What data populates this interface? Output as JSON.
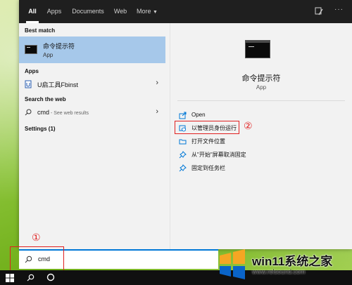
{
  "tabs": [
    {
      "label": "All",
      "active": true
    },
    {
      "label": "Apps"
    },
    {
      "label": "Documents"
    },
    {
      "label": "Web"
    },
    {
      "label": "More"
    }
  ],
  "left": {
    "best_match_header": "Best match",
    "best_match": {
      "title": "命令提示符",
      "subtitle": "App"
    },
    "apps_header": "Apps",
    "app_item": "U启工具Fbinst",
    "web_header": "Search the web",
    "web_item": {
      "term": "cmd",
      "suffix": " - See web results"
    },
    "settings_header": "Settings (1)"
  },
  "detail": {
    "title": "命令提示符",
    "subtitle": "App",
    "actions": [
      {
        "label": "Open",
        "icon": "open-icon"
      },
      {
        "label": "以管理员身份运行",
        "icon": "shield-icon"
      },
      {
        "label": "打开文件位置",
        "icon": "folder-icon"
      },
      {
        "label": "从\"开始\"屏幕取消固定",
        "icon": "unpin-icon"
      },
      {
        "label": "固定到任务栏",
        "icon": "pin-icon"
      }
    ]
  },
  "search": {
    "value": "cmd"
  },
  "annotations": {
    "step1": "①",
    "step2": "②"
  },
  "watermark": {
    "text": "win11系统之家",
    "url": "www.relsound.com"
  },
  "colors": {
    "accent": "#0078d7",
    "selection": "#a6c8ea",
    "annotation": "#e02020"
  }
}
